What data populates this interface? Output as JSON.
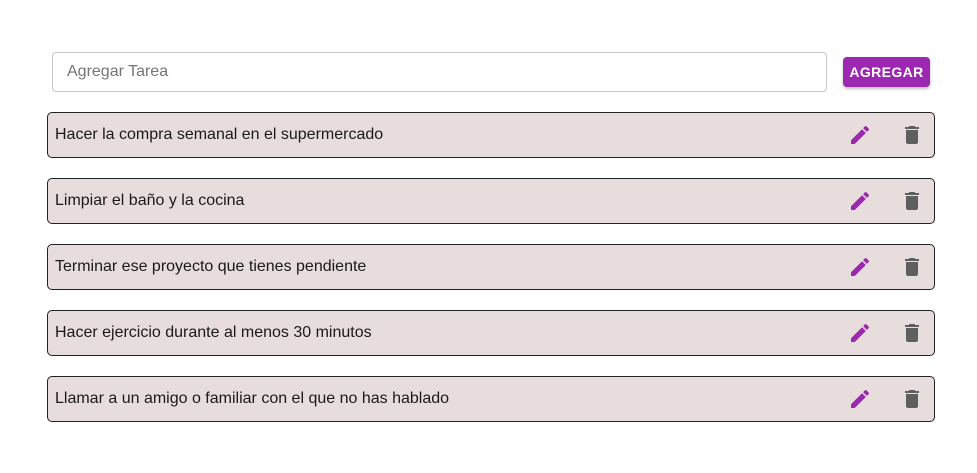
{
  "add_task": {
    "placeholder": "Agregar Tarea",
    "value": "",
    "button_label": "AGREGAR"
  },
  "colors": {
    "accent": "#9c27b0",
    "item_background": "#e8dddd",
    "delete_icon": "#5f5f5f"
  },
  "icons": {
    "edit": "pencil-icon",
    "delete": "trash-icon"
  },
  "tasks": [
    {
      "text": "Hacer la compra semanal en el supermercado"
    },
    {
      "text": "Limpiar el baño y la cocina"
    },
    {
      "text": "Terminar ese proyecto que tienes pendiente"
    },
    {
      "text": "Hacer ejercicio durante al menos 30 minutos"
    },
    {
      "text": "Llamar a un amigo o familiar con el que no has hablado"
    }
  ]
}
